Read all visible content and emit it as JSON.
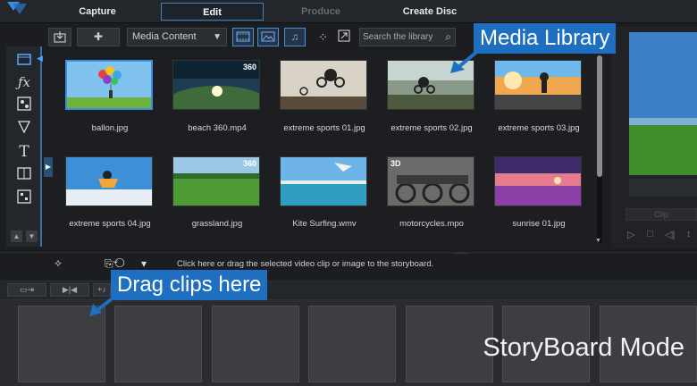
{
  "tabs": [
    {
      "label": "Capture",
      "state": "normal"
    },
    {
      "label": "Edit",
      "state": "active"
    },
    {
      "label": "Produce",
      "state": "disabled"
    },
    {
      "label": "Create Disc",
      "state": "normal"
    }
  ],
  "library": {
    "filter": "Media Content",
    "search_placeholder": "Search the library",
    "items": [
      {
        "label": "ballon.jpg",
        "badge": ""
      },
      {
        "label": "beach 360.mp4",
        "badge": "360"
      },
      {
        "label": "extreme sports 01.jpg",
        "badge": ""
      },
      {
        "label": "extreme sports 02.jpg",
        "badge": ""
      },
      {
        "label": "extreme sports 03.jpg",
        "badge": ""
      },
      {
        "label": "extreme sports 04.jpg",
        "badge": ""
      },
      {
        "label": "grassland.jpg",
        "badge": "360"
      },
      {
        "label": "Kite Surfing.wmv",
        "badge": ""
      },
      {
        "label": "motorcycles.mpo",
        "badge": "3D"
      },
      {
        "label": "sunrise 01.jpg",
        "badge": ""
      }
    ]
  },
  "preview": {
    "clip_label": "Clip"
  },
  "hint": "Click here or drag the selected video clip or image to the storyboard.",
  "callouts": {
    "media_library": "Media Library",
    "drag_clips": "Drag clips here"
  },
  "storyboard_mode": "StoryBoard Mode",
  "colors": {
    "accent": "#1e6fc0",
    "selection": "#3f8de0",
    "background": "#1b1d20"
  }
}
